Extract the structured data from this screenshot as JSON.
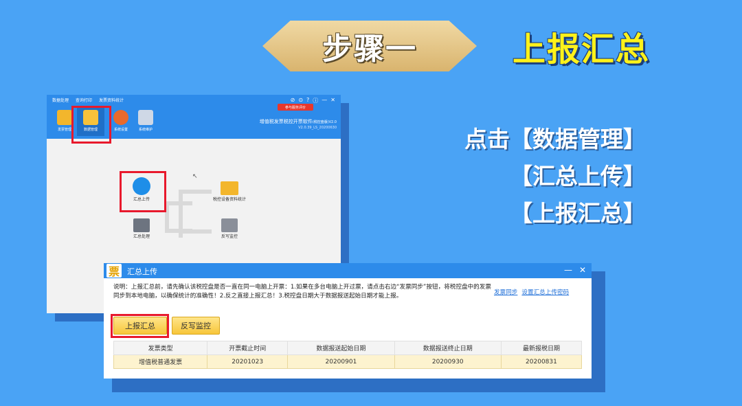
{
  "banner": {
    "step": "步骤一",
    "title": "上报汇总"
  },
  "instructions": {
    "line1": "点击【数据管理】",
    "line2": "【汇总上传】",
    "line3": "【上报汇总】"
  },
  "app": {
    "menu": [
      "数据处理",
      "查询打印",
      "发票资料统计"
    ],
    "eval_button": "参与服务评价",
    "name": "增值税发票税控开票软件",
    "name_suffix": "(税控盘版)V2.0",
    "version": "V2.0.39_LS_20200630",
    "toolbar": {
      "t1": "发票管理",
      "t2": "数据管理",
      "t3": "系统设置",
      "t4": "系统维护"
    },
    "flow": {
      "upload": "汇总上传",
      "process": "汇总处理",
      "stats": "税控设备资料统计",
      "writeback": "反写监控"
    }
  },
  "dialog": {
    "logo": "票",
    "title": "汇总上传",
    "note": "说明：上报汇总前，请先确认该税控盘是否一直在同一电脑上开票：1.如果在多台电脑上开过票，请点击右边“发票同步”按钮，将税控盘中的发票同步到本地电脑，以确保统计的准确性！2.反之直接上报汇总！3.税控盘日期大于数据报送起始日期才能上报。",
    "link_sync": "发票同步",
    "link_pwd": "设置汇总上传密码",
    "btn_report": "上报汇总",
    "btn_writeback": "反写监控",
    "table": {
      "headers": [
        "发票类型",
        "开票截止时间",
        "数据报送起始日期",
        "数据报送终止日期",
        "最新报税日期"
      ],
      "rows": [
        [
          "增值税普通发票",
          "20201023",
          "20200901",
          "20200930",
          "20200831"
        ]
      ]
    }
  },
  "colors": {
    "background": "#4aa3f5",
    "highlight_red": "#e8192c",
    "title_yellow": "#fff21a"
  }
}
